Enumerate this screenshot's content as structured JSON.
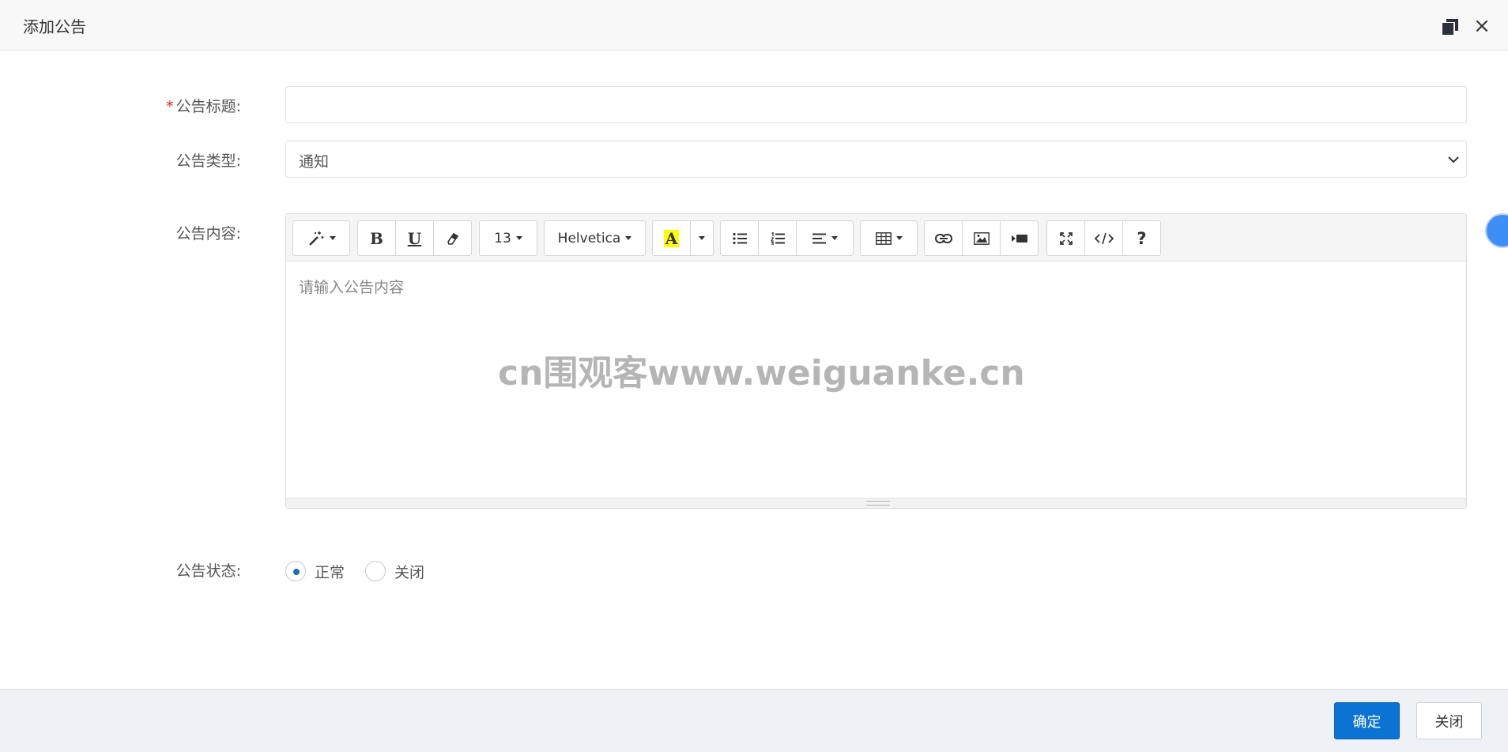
{
  "dialog": {
    "title": "添加公告",
    "maximize_icon": "maximize-icon",
    "close_icon": "close-icon",
    "close_glyph": "×"
  },
  "form": {
    "title_field": {
      "required_mark": "*",
      "label": "公告标题:",
      "value": ""
    },
    "type_field": {
      "label": "公告类型:",
      "selected": "通知"
    },
    "content_field": {
      "label": "公告内容:",
      "placeholder": "请输入公告内容"
    },
    "status_field": {
      "label": "公告状态:",
      "options": [
        {
          "label": "正常",
          "checked": true
        },
        {
          "label": "关闭",
          "checked": false
        }
      ]
    }
  },
  "toolbar": {
    "font_size": "13",
    "font_name": "Helvetica",
    "bold": "B",
    "underline": "U",
    "color_letter": "A",
    "highlight_color": "#ffff00",
    "help": "?"
  },
  "watermark": "cn围观客www.weiguanke.cn",
  "footer": {
    "ok_label": "确定",
    "cancel_label": "关闭",
    "ok_color": "#0b73d3"
  }
}
